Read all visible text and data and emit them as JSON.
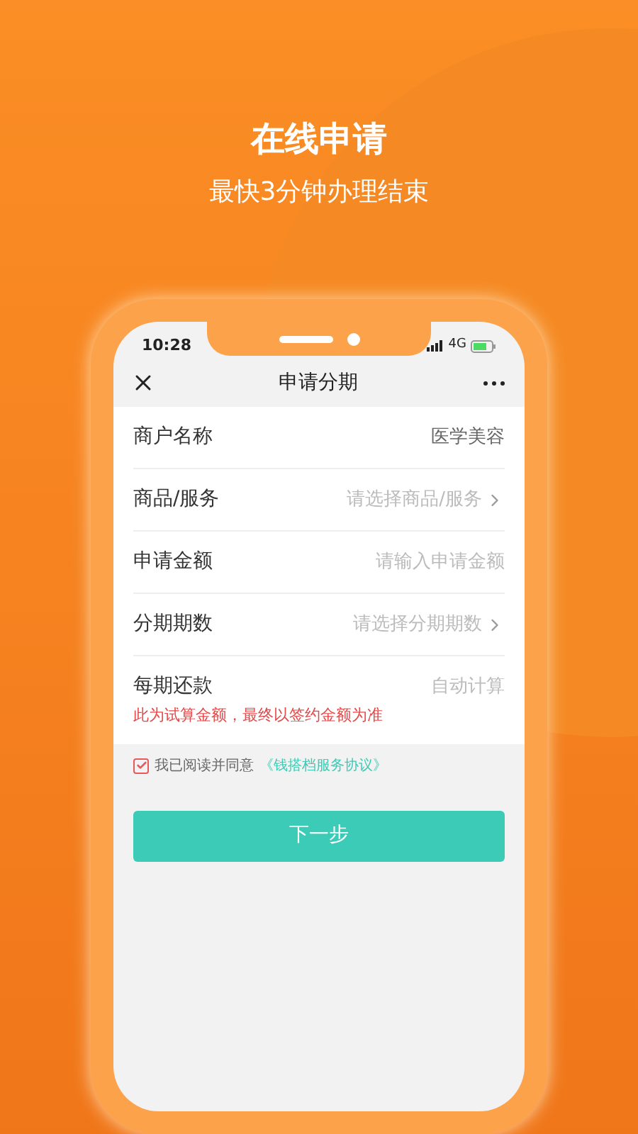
{
  "headline": "在线申请",
  "subtitle": "最快3分钟办理结束",
  "status_bar": {
    "time": "10:28",
    "network": "4G"
  },
  "nav": {
    "title": "申请分期"
  },
  "form_rows": [
    {
      "kind": "value",
      "label": "商户名称",
      "value": "医学美容"
    },
    {
      "kind": "select",
      "label": "商品/服务",
      "placeholder": "请选择商品/服务"
    },
    {
      "kind": "input",
      "label": "申请金额",
      "placeholder": "请输入申请金额"
    },
    {
      "kind": "select",
      "label": "分期期数",
      "placeholder": "请选择分期期数"
    },
    {
      "kind": "computed",
      "label": "每期还款",
      "placeholder": "自动计算",
      "note": "此为试算金额，最终以签约金额为准"
    }
  ],
  "agreement": {
    "checked": true,
    "text": "我已阅读并同意",
    "link": "《钱搭档服务协议》"
  },
  "next_button": "下一步"
}
